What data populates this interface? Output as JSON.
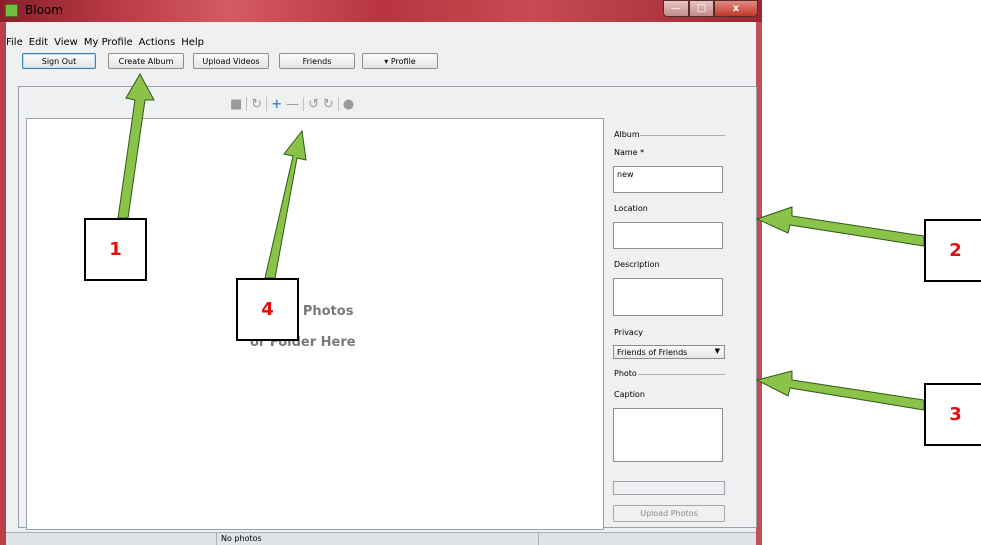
{
  "window": {
    "title": "Bloom",
    "controls": {
      "minimize": "—",
      "maximize": "□",
      "close": "x"
    }
  },
  "menu": [
    "File",
    "Edit",
    "View",
    "My Profile",
    "Actions",
    "Help"
  ],
  "toolbar": {
    "sign_out": "Sign Out",
    "create_album": "Create Album",
    "upload_videos": "Upload Videos",
    "friends": "Friends",
    "profile": "▾ Profile"
  },
  "photo_toolbar_icons": [
    "folder-icon",
    "rotate-icon",
    "add-icon",
    "remove-icon",
    "rotate-left-icon",
    "rotate-right-icon",
    "person-icon"
  ],
  "dropzone": {
    "line1": "g Photos",
    "line2": "or Folder Here"
  },
  "album_panel": {
    "section_album": "Album",
    "name_label": "Name *",
    "name_value": "new",
    "location_label": "Location",
    "location_value": "",
    "description_label": "Description",
    "description_value": "",
    "privacy_label": "Privacy",
    "privacy_value": "Friends of Friends",
    "section_photo": "Photo",
    "caption_label": "Caption",
    "caption_value": "",
    "upload_button": "Upload Photos"
  },
  "status": {
    "text": "No photos"
  },
  "callouts": [
    "1",
    "2",
    "3",
    "4"
  ],
  "colors": {
    "callout_text": "#e11010",
    "arrow_fill": "#8bc34a",
    "titlebar": "#b93a44"
  }
}
